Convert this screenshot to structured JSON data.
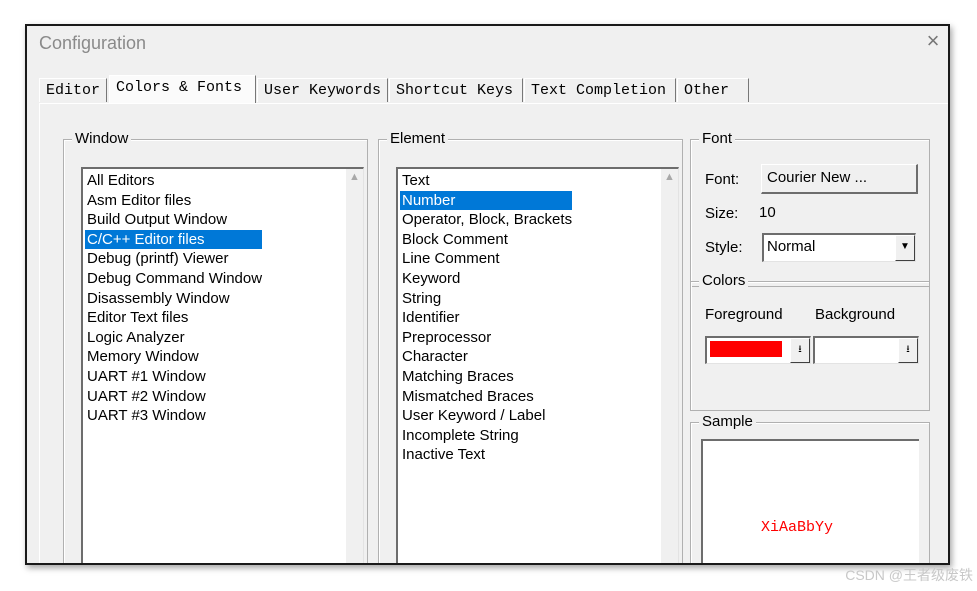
{
  "window": {
    "title": "Configuration",
    "close_glyph": "×"
  },
  "tabs": [
    {
      "label": "Editor"
    },
    {
      "label": "Colors & Fonts",
      "active": true
    },
    {
      "label": "User Keywords"
    },
    {
      "label": "Shortcut Keys"
    },
    {
      "label": "Text Completion"
    },
    {
      "label": "Other"
    }
  ],
  "window_group": {
    "legend": "Window",
    "items": [
      "All Editors",
      "Asm Editor files",
      "Build Output Window",
      "C/C++ Editor files",
      "Debug (printf) Viewer",
      "Debug Command Window",
      "Disassembly Window",
      "Editor Text files",
      "Logic Analyzer",
      "Memory Window",
      "UART #1 Window",
      "UART #2 Window",
      "UART #3 Window"
    ],
    "selected_index": 3
  },
  "element_group": {
    "legend": "Element",
    "items": [
      "Text",
      "Number",
      "Operator, Block, Brackets",
      "Block Comment",
      "Line Comment",
      "Keyword",
      "String",
      "Identifier",
      "Preprocessor",
      "Character",
      "Matching Braces",
      "Mismatched Braces",
      "User Keyword / Label",
      "Incomplete String",
      "Inactive Text"
    ],
    "selected_index": 1
  },
  "font_group": {
    "legend": "Font",
    "font_label": "Font:",
    "font_button": "Courier New ...",
    "size_label": "Size:",
    "size_value": "10",
    "style_label": "Style:",
    "style_value": "Normal"
  },
  "colors_group": {
    "legend": "Colors",
    "foreground_label": "Foreground",
    "background_label": "Background",
    "foreground_color": "#ff0000",
    "background_color": "#ffffff"
  },
  "sample_group": {
    "legend": "Sample",
    "sample_text": "XiAaBbYy",
    "sample_color": "#ff0000"
  },
  "watermark": "CSDN @王者级废铁",
  "colors": {
    "selection": "#0078d7"
  }
}
